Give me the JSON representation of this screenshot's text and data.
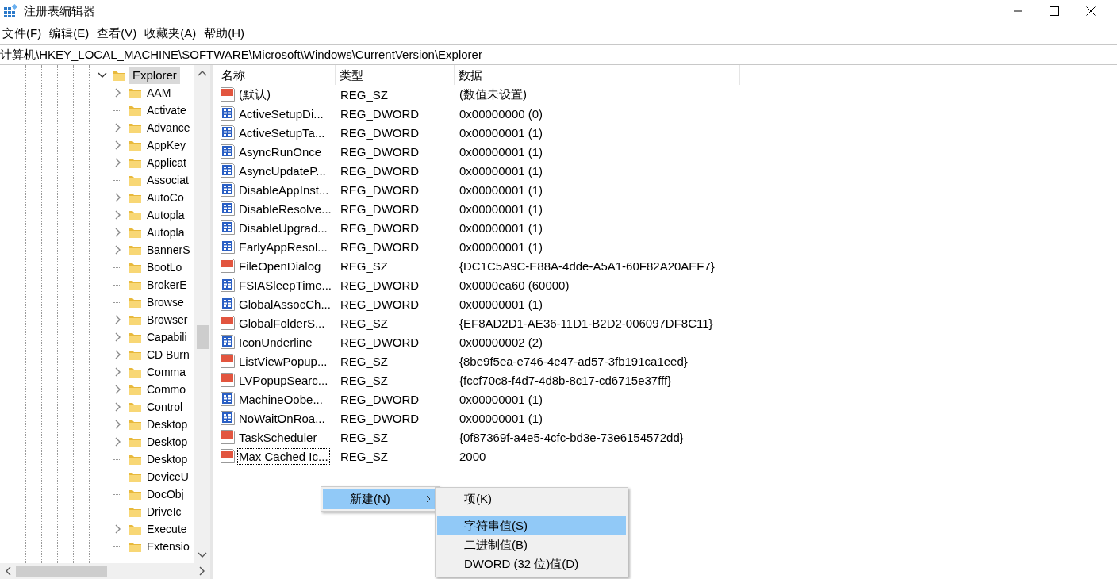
{
  "window": {
    "title": "注册表编辑器"
  },
  "menu_bar": [
    "文件(F)",
    "编辑(E)",
    "查看(V)",
    "收藏夹(A)",
    "帮助(H)"
  ],
  "address_bar": "计算机\\HKEY_LOCAL_MACHINE\\SOFTWARE\\Microsoft\\Windows\\CurrentVersion\\Explorer",
  "tree": {
    "label": "Explorer",
    "expanded": true,
    "selected": true,
    "children": [
      {
        "label": "AAM",
        "expandable": true
      },
      {
        "label": "Activate",
        "expandable": false
      },
      {
        "label": "Advance",
        "expandable": true
      },
      {
        "label": "AppKey",
        "expandable": true
      },
      {
        "label": "Applicat",
        "expandable": true
      },
      {
        "label": "Associat",
        "expandable": false
      },
      {
        "label": "AutoCo",
        "expandable": true
      },
      {
        "label": "Autopla",
        "expandable": true
      },
      {
        "label": "Autopla",
        "expandable": true
      },
      {
        "label": "BannerS",
        "expandable": true
      },
      {
        "label": "BootLo",
        "expandable": false
      },
      {
        "label": "BrokerE",
        "expandable": false
      },
      {
        "label": "Browse",
        "expandable": false
      },
      {
        "label": "Browser",
        "expandable": true
      },
      {
        "label": "Capabili",
        "expandable": true
      },
      {
        "label": "CD Burn",
        "expandable": true
      },
      {
        "label": "Comma",
        "expandable": true
      },
      {
        "label": "Commo",
        "expandable": true
      },
      {
        "label": "Control",
        "expandable": true
      },
      {
        "label": "Desktop",
        "expandable": true
      },
      {
        "label": "Desktop",
        "expandable": true
      },
      {
        "label": "Desktop",
        "expandable": false
      },
      {
        "label": "DeviceU",
        "expandable": false
      },
      {
        "label": "DocObj",
        "expandable": false
      },
      {
        "label": "DriveIc",
        "expandable": false
      },
      {
        "label": "Execute",
        "expandable": true
      },
      {
        "label": "Extensio",
        "expandable": false
      }
    ]
  },
  "table": {
    "columns": [
      "名称",
      "类型",
      "数据"
    ],
    "rows": [
      {
        "kind": "sz",
        "name": "(默认)",
        "type": "REG_SZ",
        "data": "(数值未设置)",
        "focused": false
      },
      {
        "kind": "dword",
        "name": "ActiveSetupDi...",
        "type": "REG_DWORD",
        "data": "0x00000000 (0)",
        "focused": false
      },
      {
        "kind": "dword",
        "name": "ActiveSetupTa...",
        "type": "REG_DWORD",
        "data": "0x00000001 (1)",
        "focused": false
      },
      {
        "kind": "dword",
        "name": "AsyncRunOnce",
        "type": "REG_DWORD",
        "data": "0x00000001 (1)",
        "focused": false
      },
      {
        "kind": "dword",
        "name": "AsyncUpdateP...",
        "type": "REG_DWORD",
        "data": "0x00000001 (1)",
        "focused": false
      },
      {
        "kind": "dword",
        "name": "DisableAppInst...",
        "type": "REG_DWORD",
        "data": "0x00000001 (1)",
        "focused": false
      },
      {
        "kind": "dword",
        "name": "DisableResolve...",
        "type": "REG_DWORD",
        "data": "0x00000001 (1)",
        "focused": false
      },
      {
        "kind": "dword",
        "name": "DisableUpgrad...",
        "type": "REG_DWORD",
        "data": "0x00000001 (1)",
        "focused": false
      },
      {
        "kind": "dword",
        "name": "EarlyAppResol...",
        "type": "REG_DWORD",
        "data": "0x00000001 (1)",
        "focused": false
      },
      {
        "kind": "sz",
        "name": "FileOpenDialog",
        "type": "REG_SZ",
        "data": "{DC1C5A9C-E88A-4dde-A5A1-60F82A20AEF7}",
        "focused": false
      },
      {
        "kind": "dword",
        "name": "FSIASleepTime...",
        "type": "REG_DWORD",
        "data": "0x0000ea60 (60000)",
        "focused": false
      },
      {
        "kind": "dword",
        "name": "GlobalAssocCh...",
        "type": "REG_DWORD",
        "data": "0x00000001 (1)",
        "focused": false
      },
      {
        "kind": "sz",
        "name": "GlobalFolderS...",
        "type": "REG_SZ",
        "data": "{EF8AD2D1-AE36-11D1-B2D2-006097DF8C11}",
        "focused": false
      },
      {
        "kind": "dword",
        "name": "IconUnderline",
        "type": "REG_DWORD",
        "data": "0x00000002 (2)",
        "focused": false
      },
      {
        "kind": "sz",
        "name": "ListViewPopup...",
        "type": "REG_SZ",
        "data": "{8be9f5ea-e746-4e47-ad57-3fb191ca1eed}",
        "focused": false
      },
      {
        "kind": "sz",
        "name": "LVPopupSearc...",
        "type": "REG_SZ",
        "data": "{fccf70c8-f4d7-4d8b-8c17-cd6715e37fff}",
        "focused": false
      },
      {
        "kind": "dword",
        "name": "MachineOobe...",
        "type": "REG_DWORD",
        "data": "0x00000001 (1)",
        "focused": false
      },
      {
        "kind": "dword",
        "name": "NoWaitOnRoa...",
        "type": "REG_DWORD",
        "data": "0x00000001 (1)",
        "focused": false
      },
      {
        "kind": "sz",
        "name": "TaskScheduler",
        "type": "REG_SZ",
        "data": "{0f87369f-a4e5-4cfc-bd3e-73e6154572dd}",
        "focused": false
      },
      {
        "kind": "sz",
        "name": "Max Cached Ic...",
        "type": "REG_SZ",
        "data": "2000",
        "focused": true
      }
    ]
  },
  "context_menu": {
    "items": [
      {
        "label": "新建(N)",
        "submenu": true,
        "selected": true
      }
    ]
  },
  "submenu": {
    "items": [
      {
        "kind": "item",
        "label": "项(K)",
        "selected": false
      },
      {
        "kind": "separator"
      },
      {
        "kind": "item",
        "label": "字符串值(S)",
        "selected": true
      },
      {
        "kind": "item",
        "label": "二进制值(B)",
        "selected": false
      },
      {
        "kind": "item",
        "label": "DWORD (32 位)值(D)",
        "selected": false
      }
    ]
  }
}
